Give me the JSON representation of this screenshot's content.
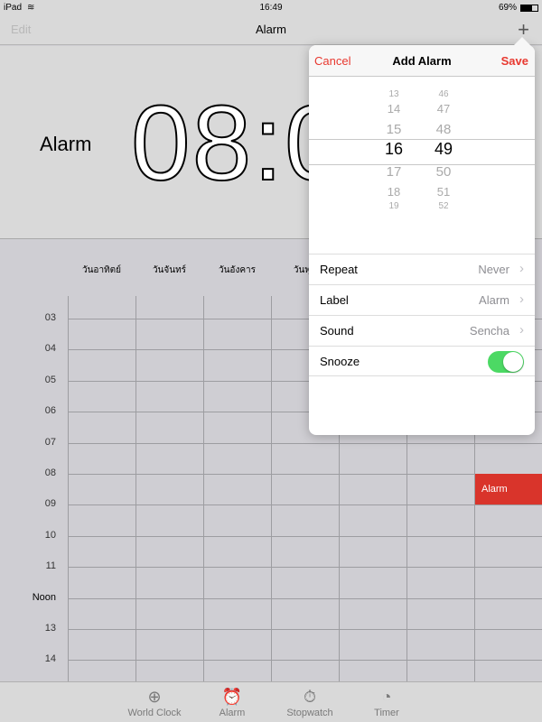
{
  "status": {
    "device": "iPad",
    "time": "16:49",
    "battery": "69%"
  },
  "nav": {
    "edit": "Edit",
    "title": "Alarm",
    "add": "+"
  },
  "hero": {
    "label": "Alarm",
    "time": "08:00"
  },
  "days": [
    "วันอาทิตย์",
    "วันจันทร์",
    "วันอังคาร",
    "วันพุธ"
  ],
  "hours": [
    "03",
    "04",
    "05",
    "06",
    "07",
    "08",
    "09",
    "10",
    "11",
    "Noon",
    "13",
    "14"
  ],
  "event": {
    "label": "Alarm",
    "color": "#d9342b"
  },
  "tabs": [
    {
      "label": "World Clock",
      "icon": "globe-icon"
    },
    {
      "label": "Alarm",
      "icon": "alarm-clock-icon"
    },
    {
      "label": "Stopwatch",
      "icon": "stopwatch-icon"
    },
    {
      "label": "Timer",
      "icon": "timer-icon"
    }
  ],
  "popover": {
    "cancel": "Cancel",
    "title": "Add Alarm",
    "save": "Save",
    "hours": [
      "13",
      "14",
      "15",
      "16",
      "17",
      "18",
      "19"
    ],
    "minutes": [
      "46",
      "47",
      "48",
      "49",
      "50",
      "51",
      "52"
    ],
    "selected_hour": "16",
    "selected_minute": "49",
    "rows": [
      {
        "key": "Repeat",
        "value": "Never"
      },
      {
        "key": "Label",
        "value": "Alarm"
      },
      {
        "key": "Sound",
        "value": "Sencha"
      },
      {
        "key": "Snooze",
        "toggle": true
      }
    ]
  },
  "colors": {
    "accent": "#e8382f",
    "toggle_on": "#4cd964"
  }
}
